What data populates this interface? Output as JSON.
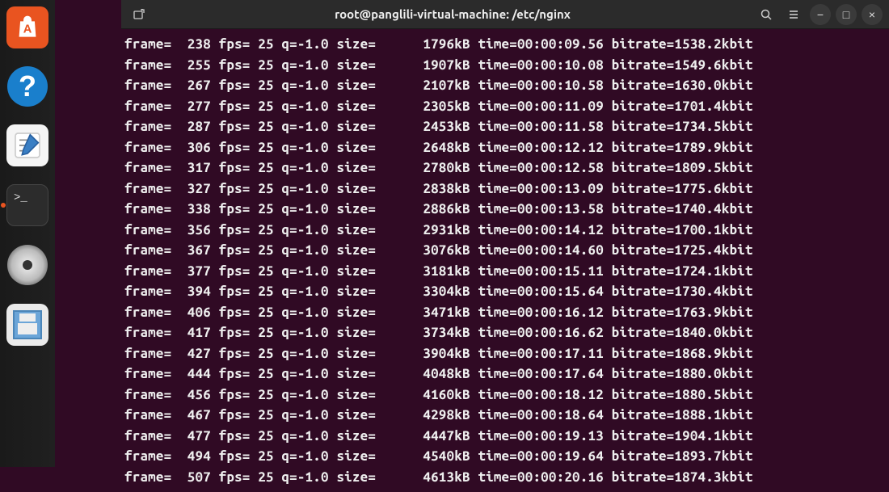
{
  "dock": {
    "items": [
      {
        "name": "software-center",
        "label": "A"
      },
      {
        "name": "help",
        "label": "?"
      },
      {
        "name": "text-editor",
        "label": ""
      },
      {
        "name": "terminal",
        "label": ">_"
      },
      {
        "name": "disk",
        "label": ""
      },
      {
        "name": "save",
        "label": ""
      }
    ]
  },
  "titlebar": {
    "title": "root@panglili-virtual-machine: /etc/nginx",
    "new_tab_label": "+",
    "search_label": "search",
    "menu_label": "menu",
    "minimize_label": "−",
    "maximize_label": "□",
    "close_label": "×"
  },
  "terminal": {
    "columns": [
      "frame",
      "fps",
      "q",
      "size",
      "time",
      "bitrate"
    ],
    "lines": [
      {
        "frame": 238,
        "fps": 25,
        "q": "-1.0",
        "size": "1796kB",
        "time": "00:00:09.56",
        "bitrate": "1538.2kbit"
      },
      {
        "frame": 255,
        "fps": 25,
        "q": "-1.0",
        "size": "1907kB",
        "time": "00:00:10.08",
        "bitrate": "1549.6kbit"
      },
      {
        "frame": 267,
        "fps": 25,
        "q": "-1.0",
        "size": "2107kB",
        "time": "00:00:10.58",
        "bitrate": "1630.0kbit"
      },
      {
        "frame": 277,
        "fps": 25,
        "q": "-1.0",
        "size": "2305kB",
        "time": "00:00:11.09",
        "bitrate": "1701.4kbit"
      },
      {
        "frame": 287,
        "fps": 25,
        "q": "-1.0",
        "size": "2453kB",
        "time": "00:00:11.58",
        "bitrate": "1734.5kbit"
      },
      {
        "frame": 306,
        "fps": 25,
        "q": "-1.0",
        "size": "2648kB",
        "time": "00:00:12.12",
        "bitrate": "1789.9kbit"
      },
      {
        "frame": 317,
        "fps": 25,
        "q": "-1.0",
        "size": "2780kB",
        "time": "00:00:12.58",
        "bitrate": "1809.5kbit"
      },
      {
        "frame": 327,
        "fps": 25,
        "q": "-1.0",
        "size": "2838kB",
        "time": "00:00:13.09",
        "bitrate": "1775.6kbit"
      },
      {
        "frame": 338,
        "fps": 25,
        "q": "-1.0",
        "size": "2886kB",
        "time": "00:00:13.58",
        "bitrate": "1740.4kbit"
      },
      {
        "frame": 356,
        "fps": 25,
        "q": "-1.0",
        "size": "2931kB",
        "time": "00:00:14.12",
        "bitrate": "1700.1kbit"
      },
      {
        "frame": 367,
        "fps": 25,
        "q": "-1.0",
        "size": "3076kB",
        "time": "00:00:14.60",
        "bitrate": "1725.4kbit"
      },
      {
        "frame": 377,
        "fps": 25,
        "q": "-1.0",
        "size": "3181kB",
        "time": "00:00:15.11",
        "bitrate": "1724.1kbit"
      },
      {
        "frame": 394,
        "fps": 25,
        "q": "-1.0",
        "size": "3304kB",
        "time": "00:00:15.64",
        "bitrate": "1730.4kbit"
      },
      {
        "frame": 406,
        "fps": 25,
        "q": "-1.0",
        "size": "3471kB",
        "time": "00:00:16.12",
        "bitrate": "1763.9kbit"
      },
      {
        "frame": 417,
        "fps": 25,
        "q": "-1.0",
        "size": "3734kB",
        "time": "00:00:16.62",
        "bitrate": "1840.0kbit"
      },
      {
        "frame": 427,
        "fps": 25,
        "q": "-1.0",
        "size": "3904kB",
        "time": "00:00:17.11",
        "bitrate": "1868.9kbit"
      },
      {
        "frame": 444,
        "fps": 25,
        "q": "-1.0",
        "size": "4048kB",
        "time": "00:00:17.64",
        "bitrate": "1880.0kbit"
      },
      {
        "frame": 456,
        "fps": 25,
        "q": "-1.0",
        "size": "4160kB",
        "time": "00:00:18.12",
        "bitrate": "1880.5kbit"
      },
      {
        "frame": 467,
        "fps": 25,
        "q": "-1.0",
        "size": "4298kB",
        "time": "00:00:18.64",
        "bitrate": "1888.1kbit"
      },
      {
        "frame": 477,
        "fps": 25,
        "q": "-1.0",
        "size": "4447kB",
        "time": "00:00:19.13",
        "bitrate": "1904.1kbit"
      },
      {
        "frame": 494,
        "fps": 25,
        "q": "-1.0",
        "size": "4540kB",
        "time": "00:00:19.64",
        "bitrate": "1893.7kbit"
      },
      {
        "frame": 507,
        "fps": 25,
        "q": "-1.0",
        "size": "4613kB",
        "time": "00:00:20.16",
        "bitrate": "1874.3kbit"
      }
    ]
  }
}
